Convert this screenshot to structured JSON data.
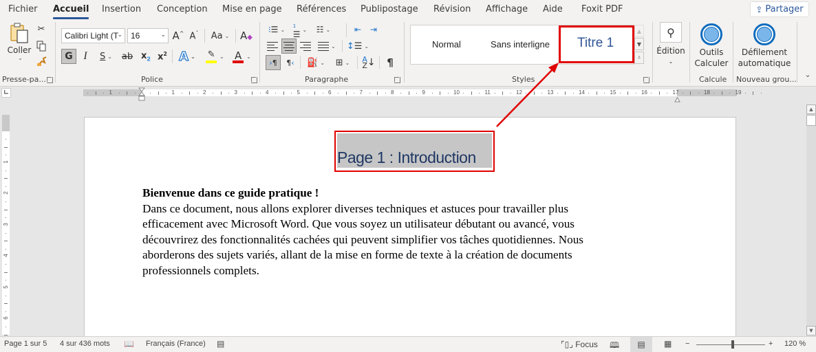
{
  "tabs": [
    {
      "label": "Fichier",
      "active": false
    },
    {
      "label": "Accueil",
      "active": true
    },
    {
      "label": "Insertion",
      "active": false
    },
    {
      "label": "Conception",
      "active": false
    },
    {
      "label": "Mise en page",
      "active": false
    },
    {
      "label": "Références",
      "active": false
    },
    {
      "label": "Publipostage",
      "active": false
    },
    {
      "label": "Révision",
      "active": false
    },
    {
      "label": "Affichage",
      "active": false
    },
    {
      "label": "Aide",
      "active": false
    },
    {
      "label": "Foxit PDF",
      "active": false
    }
  ],
  "share_label": "Partager",
  "ribbon": {
    "clipboard": {
      "paste_label": "Coller",
      "group_label": "Presse-pa..."
    },
    "font": {
      "font_name": "Calibri Light (T",
      "font_size": "16",
      "bold_label": "G",
      "italic_label": "I",
      "underline_label": "S",
      "strike_label": "ab",
      "case_label": "Aa",
      "highlight_color": "#ffff00",
      "font_color": "#e00000",
      "group_label": "Police"
    },
    "paragraph": {
      "group_label": "Paragraphe"
    },
    "styles": {
      "items": [
        "Normal",
        "Sans interligne",
        "Titre 1"
      ],
      "group_label": "Styles"
    },
    "editing": {
      "label": "Édition"
    },
    "calcule": {
      "button_label_1": "Outils",
      "button_label_2": "Calculer",
      "group_label": "Calcule"
    },
    "new_group": {
      "button_label_1": "Défilement",
      "button_label_2": "automatique",
      "group_label": "Nouveau grou..."
    }
  },
  "ruler": {
    "left_numbers": [
      "1"
    ],
    "right_numbers": [
      "1",
      "2",
      "3",
      "4",
      "5",
      "6",
      "7",
      "8",
      "9",
      "10",
      "11",
      "12",
      "13",
      "14",
      "15",
      "16",
      "17",
      "18",
      "19"
    ],
    "vertical_numbers": [
      "1",
      "2",
      "3",
      "4",
      "5",
      "6"
    ]
  },
  "document": {
    "heading": "Page 1 : Introduction",
    "intro_bold": "Bienvenue dans ce guide pratique !",
    "lines": [
      "Dans ce document, nous allons explorer diverses techniques et astuces pour travailler plus",
      "efficacement avec Microsoft Word. Que vous soyez un utilisateur débutant ou avancé, vous",
      "découvrirez des fonctionnalités cachées qui peuvent simplifier vos tâches quotidiennes. Nous",
      "aborderons des sujets variés, allant de la mise en forme de texte à la création de documents",
      "professionnels complets."
    ]
  },
  "status": {
    "page": "Page 1 sur 5",
    "words": "4 sur 436 mots",
    "language": "Français (France)",
    "focus_label": "Focus",
    "zoom_minus": "−",
    "zoom_plus": "+",
    "zoom": "120 %",
    "zoom_percent": 120
  },
  "colors": {
    "accent": "#2b579a",
    "heading_text": "#1f3864",
    "annotation_red": "#e00000",
    "titre1_text": "#2f5496"
  }
}
